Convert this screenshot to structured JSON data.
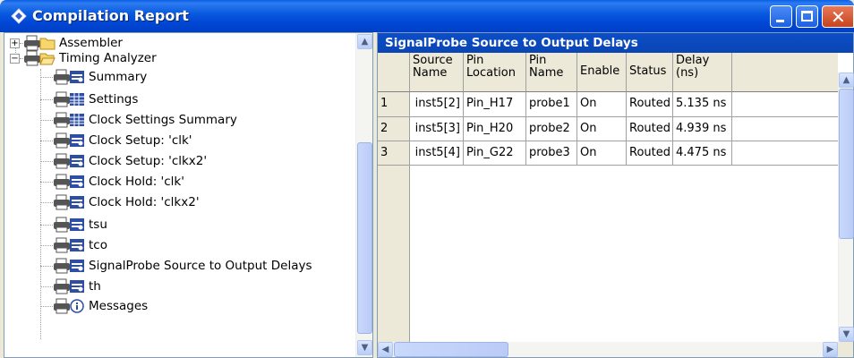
{
  "window": {
    "title": "Compilation Report"
  },
  "tree": {
    "items": [
      {
        "label": "Assembler",
        "icon": "folder-icon"
      },
      {
        "label": "Timing Analyzer",
        "icon": "folder-open-icon"
      },
      {
        "label": "Summary",
        "icon": "report-icon"
      },
      {
        "label": "Settings",
        "icon": "table-icon"
      },
      {
        "label": "Clock Settings Summary",
        "icon": "table-icon"
      },
      {
        "label": "Clock Setup: 'clk'",
        "icon": "report-icon"
      },
      {
        "label": "Clock Setup: 'clkx2'",
        "icon": "report-icon"
      },
      {
        "label": "Clock Hold: 'clk'",
        "icon": "report-icon"
      },
      {
        "label": "Clock Hold: 'clkx2'",
        "icon": "report-icon"
      },
      {
        "label": "tsu",
        "icon": "report-icon"
      },
      {
        "label": "tco",
        "icon": "report-icon"
      },
      {
        "label": "SignalProbe Source to Output Delays",
        "icon": "report-icon"
      },
      {
        "label": "th",
        "icon": "report-icon"
      },
      {
        "label": "Messages",
        "icon": "info-icon"
      }
    ]
  },
  "report": {
    "title": "SignalProbe Source to Output Delays",
    "columns": [
      {
        "line1": "Source",
        "line2": "Name"
      },
      {
        "line1": "Pin",
        "line2": "Location"
      },
      {
        "line1": "Pin",
        "line2": "Name"
      },
      {
        "line1": "Enable",
        "line2": ""
      },
      {
        "line1": "Status",
        "line2": ""
      },
      {
        "line1": "Delay",
        "line2": "(ns)"
      }
    ],
    "rows": [
      {
        "num": "1",
        "cells": [
          "inst5[2]",
          "Pin_H17",
          "probe1",
          "On",
          "Routed",
          "5.135 ns"
        ]
      },
      {
        "num": "2",
        "cells": [
          "inst5[3]",
          "Pin_H20",
          "probe2",
          "On",
          "Routed",
          "4.939 ns"
        ]
      },
      {
        "num": "3",
        "cells": [
          "inst5[4]",
          "Pin_G22",
          "probe3",
          "On",
          "Routed",
          "4.475 ns"
        ]
      }
    ]
  },
  "icons": {
    "scroll_up": "▲",
    "scroll_down": "▼",
    "scroll_left": "◀",
    "scroll_right": "▶"
  }
}
